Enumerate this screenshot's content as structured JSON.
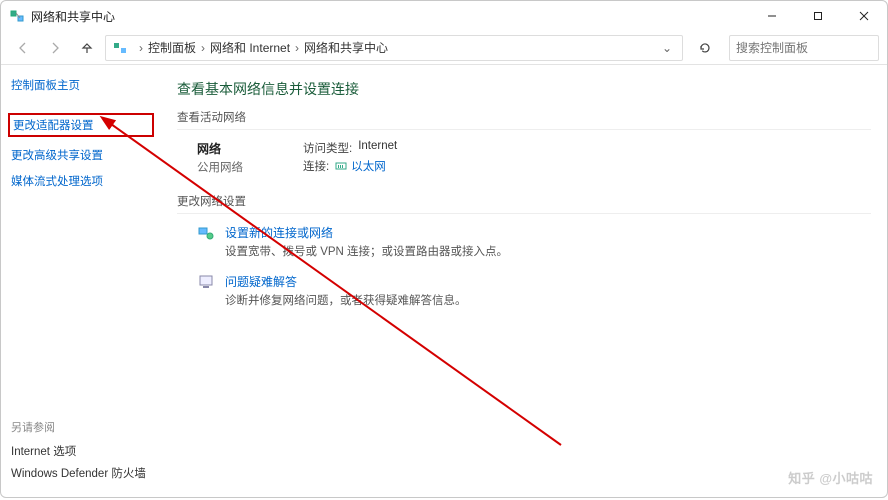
{
  "window": {
    "title": "网络和共享中心",
    "minimize": "—",
    "maximize": "▢",
    "close": "✕"
  },
  "nav": {
    "breadcrumb": [
      "控制面板",
      "网络和 Internet",
      "网络和共享中心"
    ],
    "search_placeholder": "搜索控制面板"
  },
  "sidebar": {
    "home": "控制面板主页",
    "items": [
      "更改适配器设置",
      "更改高级共享设置",
      "媒体流式处理选项"
    ],
    "seealso": "另请参阅",
    "bottom": [
      "Internet 选项",
      "Windows Defender 防火墙"
    ]
  },
  "main": {
    "heading": "查看基本网络信息并设置连接",
    "active_net_title": "查看活动网络",
    "net_name": "网络",
    "net_type": "公用网络",
    "access_label": "访问类型:",
    "access_value": "Internet",
    "conn_label": "连接:",
    "conn_value": "以太网",
    "change_title": "更改网络设置",
    "setup_title": "设置新的连接或网络",
    "setup_desc": "设置宽带、拨号或 VPN 连接；或设置路由器或接入点。",
    "troubleshoot_title": "问题疑难解答",
    "troubleshoot_desc": "诊断并修复网络问题，或者获得疑难解答信息。"
  },
  "watermark": "知乎 @小咕咕"
}
